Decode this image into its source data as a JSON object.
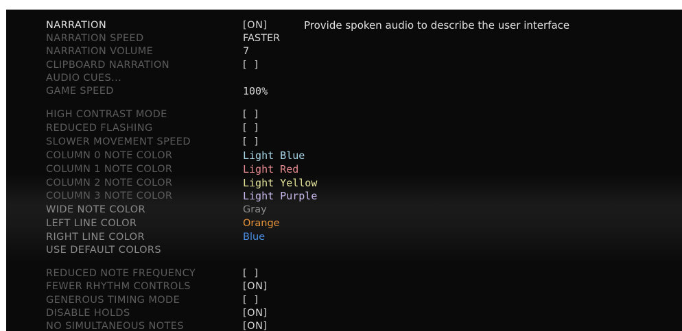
{
  "menu": {
    "description": "Provide spoken audio to describe the user interface",
    "items": [
      {
        "label": "NARRATION",
        "value": "[ON]"
      },
      {
        "label": "NARRATION SPEED",
        "value": "FASTER"
      },
      {
        "label": "NARRATION VOLUME",
        "value": "7"
      },
      {
        "label": "CLIPBOARD NARRATION",
        "value": "[  ]"
      },
      {
        "label": "AUDIO CUES...",
        "value": ""
      },
      {
        "label": "GAME SPEED",
        "value": "100%"
      },
      {
        "label": "HIGH CONTRAST MODE",
        "value": "[  ]"
      },
      {
        "label": "REDUCED FLASHING",
        "value": "[  ]"
      },
      {
        "label": "SLOWER MOVEMENT SPEED",
        "value": "[  ]"
      },
      {
        "label": "COLUMN 0 NOTE COLOR",
        "value": "Light Blue",
        "color": "#a9d6e6"
      },
      {
        "label": "COLUMN 1 NOTE COLOR",
        "value": "Light Red",
        "color": "#e6898f"
      },
      {
        "label": "COLUMN 2 NOTE COLOR",
        "value": "Light Yellow",
        "color": "#e3e39a"
      },
      {
        "label": "COLUMN 3 NOTE COLOR",
        "value": "Light Purple",
        "color": "#c8b8ec"
      },
      {
        "label": "WIDE NOTE COLOR",
        "value": "Gray",
        "color": "#8c8c8c"
      },
      {
        "label": "LEFT LINE COLOR",
        "value": "Orange",
        "color": "#e8953a"
      },
      {
        "label": "RIGHT LINE COLOR",
        "value": "Blue",
        "color": "#4a8fe6"
      },
      {
        "label": "USE DEFAULT COLORS",
        "value": ""
      },
      {
        "label": "REDUCED NOTE FREQUENCY",
        "value": "[  ]"
      },
      {
        "label": "FEWER RHYTHM CONTROLS",
        "value": "[ON]"
      },
      {
        "label": "GENEROUS TIMING MODE",
        "value": "[  ]"
      },
      {
        "label": "DISABLE HOLDS",
        "value": "[ON]"
      },
      {
        "label": "NO SIMULTANEOUS NOTES",
        "value": "[ON]"
      }
    ]
  }
}
